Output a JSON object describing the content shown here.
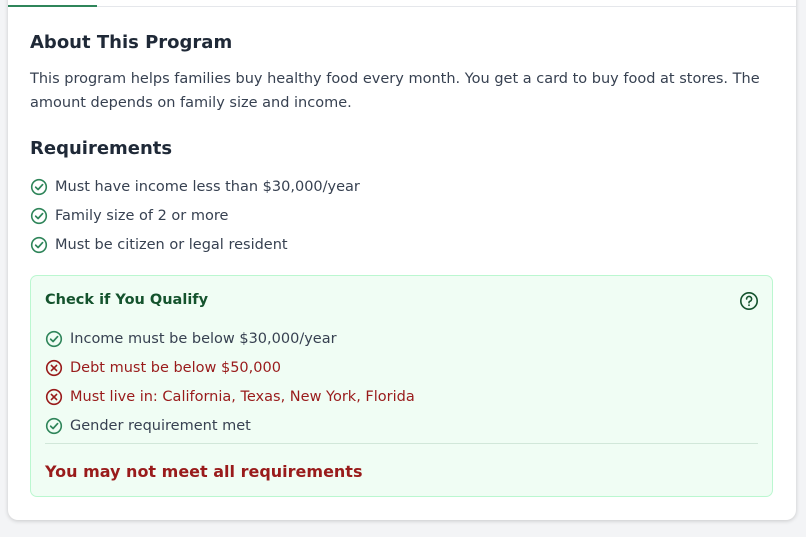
{
  "about": {
    "title": "About This Program",
    "description": "This program helps families buy healthy food every month. You get a card to buy food at stores. The amount depends on family size and income."
  },
  "requirements": {
    "title": "Requirements",
    "items": [
      {
        "label": "Must have income less than $30,000/year",
        "icon": "check-circle-icon"
      },
      {
        "label": "Family size of 2 or more",
        "icon": "check-circle-icon"
      },
      {
        "label": "Must be citizen or legal resident",
        "icon": "check-circle-icon"
      }
    ]
  },
  "qualify": {
    "title": "Check if You Qualify",
    "help_icon": "question-circle-icon",
    "checks": [
      {
        "label": "Income must be below $30,000/year",
        "status": "met",
        "icon": "check-circle-icon"
      },
      {
        "label": "Debt must be below $50,000",
        "status": "not-met",
        "icon": "x-circle-icon"
      },
      {
        "label": "Must live in: California, Texas, New York, Florida",
        "status": "not-met",
        "icon": "x-circle-icon"
      },
      {
        "label": "Gender requirement met",
        "status": "met",
        "icon": "check-circle-icon"
      }
    ],
    "result": "You may not meet all requirements"
  },
  "colors": {
    "accent_green": "#2f855a",
    "error_red": "#991b1b",
    "panel_bg": "#f0fdf4",
    "panel_border": "#bbf7d0"
  }
}
